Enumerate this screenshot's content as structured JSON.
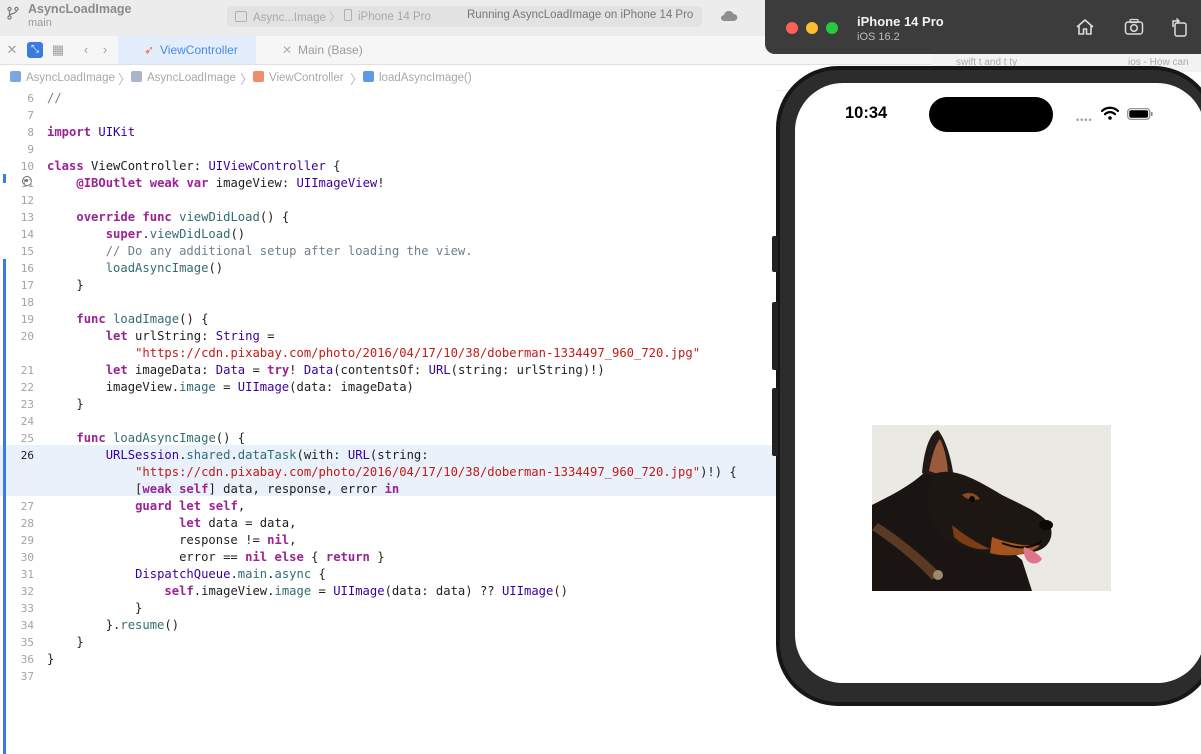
{
  "xcode": {
    "project_name": "AsyncLoadImage",
    "branch": "main",
    "scheme": {
      "app": "Async...Image",
      "device": "iPhone 14 Pro",
      "status": "Running AsyncLoadImage on iPhone 14 Pro"
    },
    "tabs": [
      {
        "label": "ViewController",
        "icon": "swift-icon",
        "active": true
      },
      {
        "label": "Main (Base)",
        "icon": "storyboard-icon",
        "active": false
      }
    ],
    "jumpbar": [
      {
        "label": "AsyncLoadImage",
        "icon": "project-icon"
      },
      {
        "label": "AsyncLoadImage",
        "icon": "folder-icon"
      },
      {
        "label": "ViewController",
        "icon": "swift-icon"
      },
      {
        "label": "loadAsyncImage()",
        "icon": "method-icon"
      }
    ],
    "background_tabs": [
      "swift t and t ty",
      "ios - How can"
    ],
    "current_line": "26",
    "colors": {
      "accent": "#3b7be0",
      "keyword": "#9b2393",
      "string": "#c41a16",
      "comment": "#707f8c"
    }
  },
  "code_lines": [
    {
      "n": "6",
      "text": "//"
    },
    {
      "n": "7",
      "text": ""
    },
    {
      "n": "8",
      "text": "import UIKit"
    },
    {
      "n": "9",
      "text": ""
    },
    {
      "n": "10",
      "text": "class ViewController: UIViewController {"
    },
    {
      "n": "11",
      "text": "    @IBOutlet weak var imageView: UIImageView!"
    },
    {
      "n": "12",
      "text": ""
    },
    {
      "n": "13",
      "text": "    override func viewDidLoad() {"
    },
    {
      "n": "14",
      "text": "        super.viewDidLoad()"
    },
    {
      "n": "15",
      "text": "        // Do any additional setup after loading the view."
    },
    {
      "n": "16",
      "text": "        loadAsyncImage()"
    },
    {
      "n": "17",
      "text": "    }"
    },
    {
      "n": "18",
      "text": ""
    },
    {
      "n": "19",
      "text": "    func loadImage() {"
    },
    {
      "n": "20",
      "text": "        let urlString: String ="
    },
    {
      "n": "",
      "text": "            \"https://cdn.pixabay.com/photo/2016/04/17/10/38/doberman-1334497_960_720.jpg\""
    },
    {
      "n": "21",
      "text": "        let imageData: Data = try! Data(contentsOf: URL(string: urlString)!)"
    },
    {
      "n": "22",
      "text": "        imageView.image = UIImage(data: imageData)"
    },
    {
      "n": "23",
      "text": "    }"
    },
    {
      "n": "24",
      "text": ""
    },
    {
      "n": "25",
      "text": "    func loadAsyncImage() {"
    },
    {
      "n": "26",
      "text": "        URLSession.shared.dataTask(with: URL(string:"
    },
    {
      "n": "",
      "text": "            \"https://cdn.pixabay.com/photo/2016/04/17/10/38/doberman-1334497_960_720.jpg\")!) {"
    },
    {
      "n": "",
      "text": "            [weak self] data, response, error in"
    },
    {
      "n": "27",
      "text": "            guard let self,"
    },
    {
      "n": "28",
      "text": "                  let data = data,"
    },
    {
      "n": "29",
      "text": "                  response != nil,"
    },
    {
      "n": "30",
      "text": "                  error == nil else { return }"
    },
    {
      "n": "31",
      "text": "            DispatchQueue.main.async {"
    },
    {
      "n": "32",
      "text": "                self.imageView.image = UIImage(data: data) ?? UIImage()"
    },
    {
      "n": "33",
      "text": "            }"
    },
    {
      "n": "34",
      "text": "        }.resume()"
    },
    {
      "n": "35",
      "text": "    }"
    },
    {
      "n": "36",
      "text": "}"
    },
    {
      "n": "37",
      "text": ""
    }
  ],
  "simulator": {
    "device_name": "iPhone 14 Pro",
    "os_version": "iOS 16.2",
    "status_time": "10:34",
    "image_subject": "doberman-photo"
  }
}
